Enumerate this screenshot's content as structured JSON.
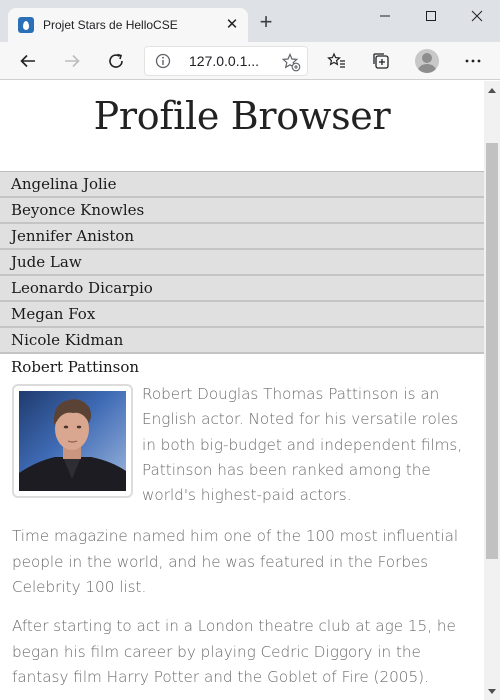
{
  "browser": {
    "tab_title": "Projet Stars de HelloCSE",
    "close_glyph": "✕",
    "new_tab_glyph": "+",
    "address_url": "127.0.0.1..."
  },
  "page": {
    "title": "Profile Browser"
  },
  "profiles": [
    {
      "name": "Angelina Jolie"
    },
    {
      "name": "Beyonce Knowles"
    },
    {
      "name": "Jennifer Aniston"
    },
    {
      "name": "Jude Law"
    },
    {
      "name": "Leonardo Dicarpio"
    },
    {
      "name": "Megan Fox"
    },
    {
      "name": "Nicole Kidman"
    },
    {
      "name": "Robert Pattinson"
    }
  ],
  "selected_profile": {
    "name": "Robert Pattinson",
    "paragraphs": [
      "Robert Douglas Thomas Pattinson is an English actor. Noted for his versatile roles in both big-budget and independent films, Pattinson has been ranked among the world's highest-paid actors.",
      "Time magazine named him one of the 100 most influential people in the world, and he was featured in the Forbes Celebrity 100 list.",
      "After starting to act in a London theatre club at age 15, he began his film career by playing Cedric Diggory in the fantasy film Harry Potter and the Goblet of Fire (2005)."
    ]
  },
  "colors": {
    "favicon": "#2b6fb6",
    "accordion_header_bg": "#e0e0e0",
    "bio_text": "#6b6b6b"
  }
}
